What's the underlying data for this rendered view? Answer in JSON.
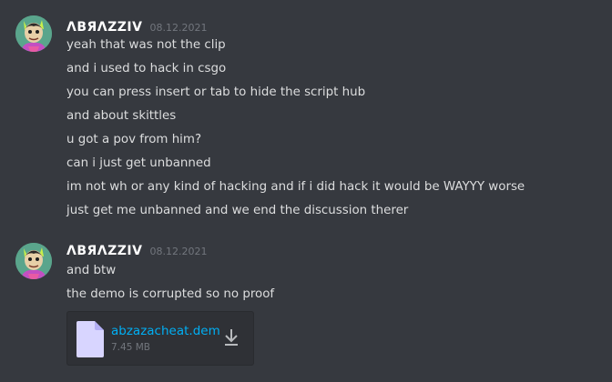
{
  "groups": [
    {
      "username": "ΛBЯΛZZIV",
      "timestamp": "08.12.2021",
      "lines": [
        "yeah that was not the clip",
        "and i used to hack in csgo",
        "you can press insert or tab to hide the script hub",
        "and about skittles",
        "u got a pov from him?",
        "can i just get unbanned",
        "im not wh or any kind of hacking and if i did hack it would be WAYYY worse",
        "just get me unbanned and we end the discussion therer"
      ]
    },
    {
      "username": "ΛBЯΛZZIV",
      "timestamp": "08.12.2021",
      "lines": [
        "and btw",
        "the demo is corrupted so no proof"
      ],
      "attachment": {
        "file_name": "abzazacheat.dem",
        "file_size": "7.45 MB",
        "icon": "file-icon",
        "action_icon": "download-icon"
      }
    }
  ],
  "colors": {
    "background": "#36393f",
    "username": "#ffffff",
    "timestamp": "#72767d",
    "text": "#dcddde",
    "link": "#00aff4",
    "attachment_bg": "#2f3136"
  }
}
